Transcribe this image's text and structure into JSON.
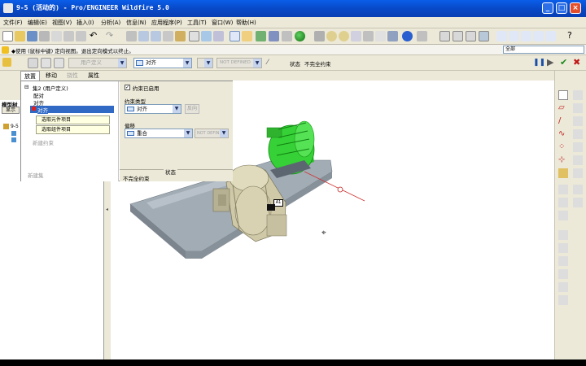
{
  "window": {
    "title": "9-5 (活动的) - Pro/ENGINEER Wildfire 5.0"
  },
  "menu": [
    "文件(F)",
    "编辑(E)",
    "视图(V)",
    "插入(I)",
    "分析(A)",
    "信息(N)",
    "应用程序(P)",
    "工具(T)",
    "窗口(W)",
    "帮助(H)"
  ],
  "message": {
    "text": "◆使用 (鼠标中键) 定向视图。退出定向模式以终止。",
    "filter": "全部"
  },
  "dashboard": {
    "user_defined": "用户定义",
    "constraint_type": "对齐",
    "offset_value": "NOT DEFINED",
    "status_label": "状态",
    "status_value": "不完全约束"
  },
  "tabs": [
    {
      "label": "放置",
      "active": true,
      "enabled": true
    },
    {
      "label": "移动",
      "active": false,
      "enabled": true
    },
    {
      "label": "挠性",
      "active": false,
      "enabled": false
    },
    {
      "label": "属性",
      "active": false,
      "enabled": true
    }
  ],
  "placement": {
    "set_label": "集2 (用户定义)",
    "items": [
      "配对",
      "对齐",
      "对齐"
    ],
    "ref_component": "选取元件项目",
    "ref_assembly": "选取组件项目",
    "new_constraint": "新建约束",
    "new_set": "新建集",
    "enabled_label": "约束已启用",
    "constraint_type_label": "约束类型",
    "constraint_type_value": "对齐",
    "flip_label": "反向",
    "offset_label": "偏移",
    "offset_type": "重合",
    "offset_value": "NOT DEFIN",
    "status_label": "状态",
    "status_value": "不完全约束"
  },
  "model_tree": {
    "header": "模型树",
    "show_btn": "显示",
    "root": "9-5"
  },
  "viewport_tag": "A1",
  "colors": {
    "titlebar": "#0a5ee8",
    "menubg": "#ece9d8",
    "selection": "#316ac5",
    "motor": "#33cc33",
    "base": "#9aa5ae"
  }
}
